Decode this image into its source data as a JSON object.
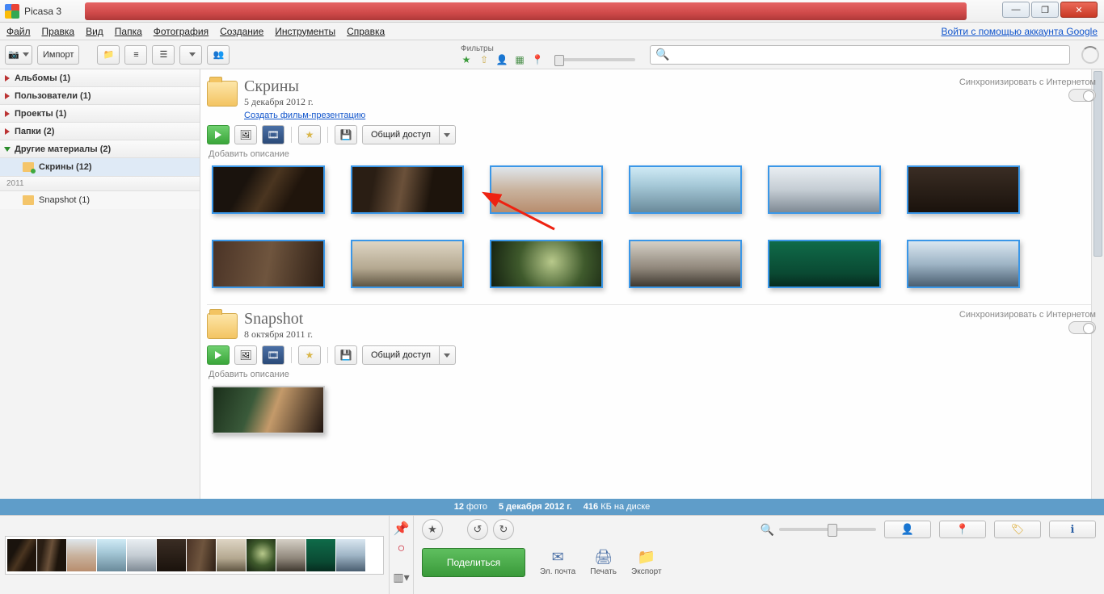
{
  "window": {
    "title": "Picasa 3"
  },
  "menu": {
    "file": "Файл",
    "edit": "Правка",
    "view": "Вид",
    "folder": "Папка",
    "photo": "Фотография",
    "create": "Создание",
    "tools": "Инструменты",
    "help": "Справка",
    "signin": "Войти с помощью аккаунта Google"
  },
  "toolbar": {
    "import": "Импорт",
    "filters_label": "Фильтры"
  },
  "sidebar": {
    "albums": "Альбомы (1)",
    "users": "Пользователи (1)",
    "projects": "Проекты (1)",
    "folders": "Папки (2)",
    "other": "Другие материалы (2)",
    "selected": "Скрины (12)",
    "year": "2011",
    "snapshot_item": "Snapshot (1)"
  },
  "folders": [
    {
      "title": "Скрины",
      "date": "5 декабря 2012 г.",
      "slideshow": "Создать фильм-презентацию",
      "share": "Общий доступ",
      "sync": "Синхронизировать с Интернетом",
      "add_desc": "Добавить описание",
      "thumb_classes": [
        "tA",
        "tB",
        "tC",
        "tD",
        "tE",
        "tF",
        "tG",
        "tH",
        "tI",
        "tJ",
        "tK",
        "tL"
      ]
    },
    {
      "title": "Snapshot",
      "date": "8 октября 2011 г.",
      "share": "Общий доступ",
      "sync": "Синхронизировать с Интернетом",
      "add_desc": "Добавить описание",
      "thumb_classes": [
        "tM"
      ]
    }
  ],
  "status": {
    "count_num": "12",
    "count_word": "фото",
    "date": "5 декабря 2012 г.",
    "size_num": "416",
    "size_word": "КБ на диске"
  },
  "bottom": {
    "share": "Поделиться",
    "email": "Эл. почта",
    "print": "Печать",
    "export": "Экспорт"
  },
  "icons": {
    "star": "★",
    "person": "👤",
    "geo": "📍",
    "globe": "🌐",
    "search": "🔍",
    "pin": "📌",
    "rec": "○",
    "undo": "↺",
    "redo": "↻",
    "mail": "✉",
    "printer": "🖨",
    "folder_export": "📁",
    "info": "ℹ",
    "tag": "🏷",
    "map": "🔍"
  },
  "colors": {
    "cyan": "#4aa6c9",
    "red": "#c23",
    "yellow": "#d9a31f",
    "blue": "#2b5fa3"
  }
}
